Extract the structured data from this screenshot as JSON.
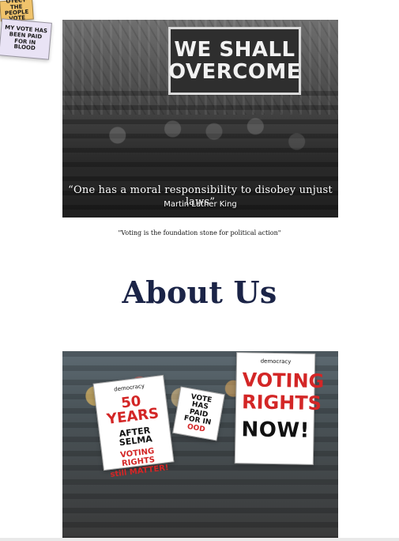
{
  "hero": {
    "sign_line_1": "WE SHALL",
    "sign_line_2": "OVERCOME",
    "quote": "“One has a moral responsibility to disobey unjust laws”",
    "author": "Martin Luther King"
  },
  "caption": "\"Voting is the foundation stone for political action\"",
  "section": {
    "title": "About Us"
  },
  "about_image": {
    "sign_selma": {
      "brand": "democracy",
      "line_1": "50 YEARS",
      "line_2": "AFTER SELMA",
      "line_3": "VOTING RIGHTS",
      "line_4": "still MATTER!"
    },
    "sign_paid": {
      "line_1": "VOTE HAS",
      "line_2": "PAID FOR IN",
      "line_3": "OOD"
    },
    "sign_voting": {
      "brand": "democracy",
      "line_1": "VOTING",
      "line_2": "RIGHTS",
      "line_3": "NOW!"
    },
    "sign_protect": {
      "text": "OTECT THE PEOPLE VOTE"
    },
    "sign_blood": {
      "text": "MY VOTE HAS BEEN PAID FOR IN BLOOD"
    }
  }
}
